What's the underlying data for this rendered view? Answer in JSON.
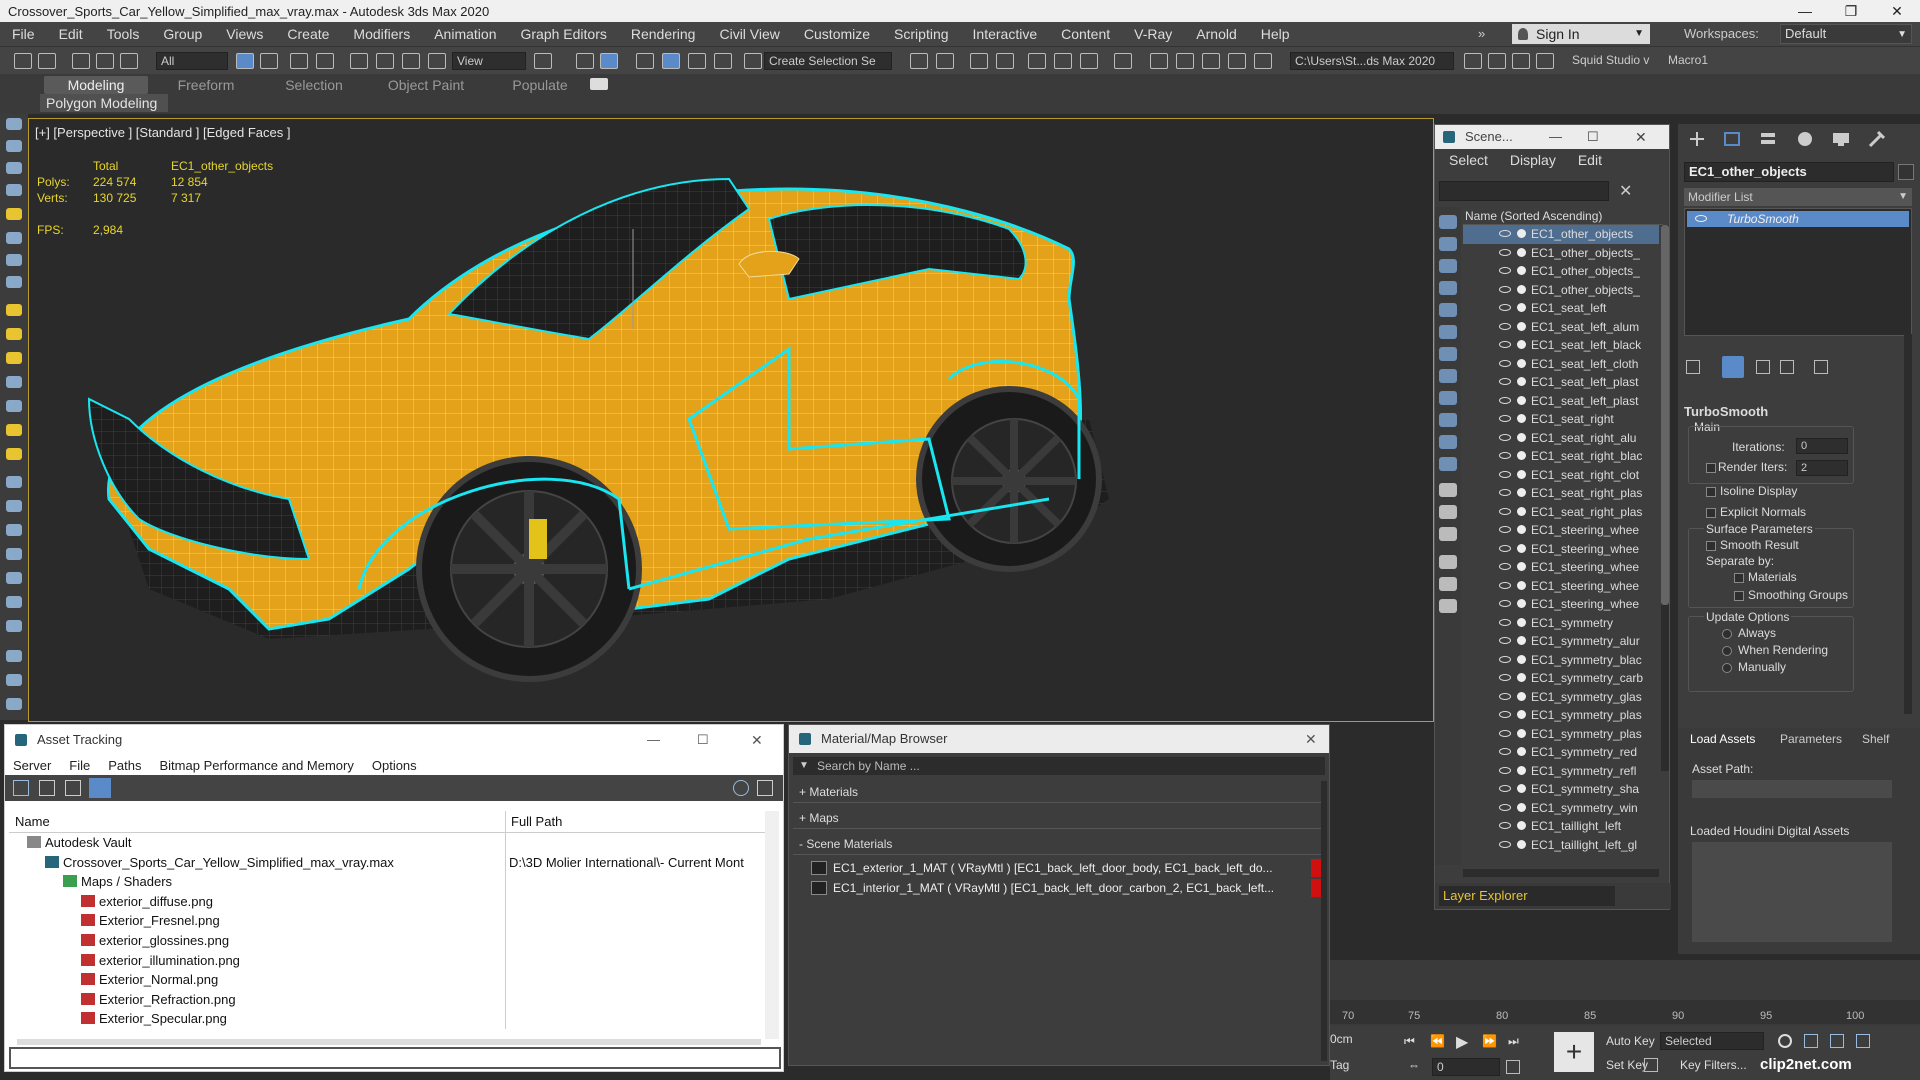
{
  "window": {
    "title": "Crossover_Sports_Car_Yellow_Simplified_max_vray.max - Autodesk 3ds Max 2020",
    "controls": [
      "—",
      "❐",
      "✕"
    ]
  },
  "menu": {
    "items": [
      "File",
      "Edit",
      "Tools",
      "Group",
      "Views",
      "Create",
      "Modifiers",
      "Animation",
      "Graph Editors",
      "Rendering",
      "Civil View",
      "Customize",
      "Scripting",
      "Interactive",
      "Content",
      "V-Ray",
      "Arnold",
      "Help"
    ],
    "more": "»",
    "signin": "Sign In",
    "workspaces_label": "Workspaces:",
    "workspace_value": "Default"
  },
  "toolbar": {
    "filter_value": "All",
    "view_value": "View",
    "selection_set": "Create Selection Se",
    "path": "C:\\Users\\St...ds Max 2020",
    "squid": "Squid Studio v",
    "macro": "Macro1"
  },
  "ribbon": {
    "tabs": [
      "Modeling",
      "Freeform",
      "Selection",
      "Object Paint",
      "Populate"
    ],
    "panel": "Polygon Modeling"
  },
  "viewport": {
    "label": "[+] [Perspective ] [Standard ] [Edged Faces ]",
    "stats": {
      "total_label": "Total",
      "object_label": "EC1_other_objects",
      "polys_label": "Polys:",
      "polys_total": "224 574",
      "polys_obj": "12 854",
      "verts_label": "Verts:",
      "verts_total": "130 725",
      "verts_obj": "7 317",
      "fps_label": "FPS:",
      "fps_value": "2,984"
    },
    "colors": {
      "body": "#e3a21a",
      "selection_outline": "#19e6f0",
      "border": "#b89a2a"
    }
  },
  "scene_explorer": {
    "title": "Scene...",
    "menu": [
      "Select",
      "Display",
      "Edit"
    ],
    "column_header": "Name (Sorted Ascending)",
    "rows": [
      "EC1_other_objects",
      "EC1_other_objects_",
      "EC1_other_objects_",
      "EC1_other_objects_",
      "EC1_seat_left",
      "EC1_seat_left_alum",
      "EC1_seat_left_black",
      "EC1_seat_left_cloth",
      "EC1_seat_left_plast",
      "EC1_seat_left_plast",
      "EC1_seat_right",
      "EC1_seat_right_alu",
      "EC1_seat_right_blac",
      "EC1_seat_right_clot",
      "EC1_seat_right_plas",
      "EC1_seat_right_plas",
      "EC1_steering_whee",
      "EC1_steering_whee",
      "EC1_steering_whee",
      "EC1_steering_whee",
      "EC1_steering_whee",
      "EC1_symmetry",
      "EC1_symmetry_alur",
      "EC1_symmetry_blac",
      "EC1_symmetry_carb",
      "EC1_symmetry_glas",
      "EC1_symmetry_plas",
      "EC1_symmetry_plas",
      "EC1_symmetry_red",
      "EC1_symmetry_refl",
      "EC1_symmetry_sha",
      "EC1_symmetry_win",
      "EC1_taillight_left",
      "EC1_taillight_left_gl"
    ],
    "footer": "Layer Explorer"
  },
  "command_panel": {
    "object_name": "EC1_other_objects",
    "modifier_list": "Modifier List",
    "stack_item": "TurboSmooth",
    "rollout_title": "TurboSmooth",
    "main_label": "Main",
    "iterations_label": "Iterations:",
    "iterations_value": "0",
    "render_iters_label": "Render Iters:",
    "render_iters_value": "2",
    "isoline": "Isoline Display",
    "explicit_normals": "Explicit Normals",
    "surface_params": "Surface Parameters",
    "smooth_result": "Smooth Result",
    "separate_by": "Separate by:",
    "materials": "Materials",
    "smoothing_groups": "Smoothing Groups",
    "update_options": "Update Options",
    "always": "Always",
    "when_rendering": "When Rendering",
    "manually": "Manually",
    "houdini_tabs": [
      "Load Assets",
      "Parameters",
      "Shelf"
    ],
    "asset_path_label": "Asset Path:",
    "loaded_label": "Loaded Houdini Digital Assets"
  },
  "asset_tracking": {
    "title": "Asset Tracking",
    "menu": [
      "Server",
      "File",
      "Paths",
      "Bitmap Performance and Memory",
      "Options"
    ],
    "col_name": "Name",
    "col_path": "Full Path",
    "rows": [
      {
        "name": "Autodesk Vault",
        "path": "",
        "indent": 1,
        "type": "vault"
      },
      {
        "name": "Crossover_Sports_Car_Yellow_Simplified_max_vray.max",
        "path": "D:\\3D Molier International\\- Current Mont",
        "indent": 2,
        "type": "max"
      },
      {
        "name": "Maps / Shaders",
        "path": "",
        "indent": 3,
        "type": "maps"
      },
      {
        "name": "exterior_diffuse.png",
        "path": "",
        "indent": 4,
        "type": "png"
      },
      {
        "name": "Exterior_Fresnel.png",
        "path": "",
        "indent": 4,
        "type": "png"
      },
      {
        "name": "exterior_glossines.png",
        "path": "",
        "indent": 4,
        "type": "png"
      },
      {
        "name": "exterior_illumination.png",
        "path": "",
        "indent": 4,
        "type": "png"
      },
      {
        "name": "Exterior_Normal.png",
        "path": "",
        "indent": 4,
        "type": "png"
      },
      {
        "name": "Exterior_Refraction.png",
        "path": "",
        "indent": 4,
        "type": "png"
      },
      {
        "name": "Exterior_Specular.png",
        "path": "",
        "indent": 4,
        "type": "png"
      }
    ]
  },
  "material_browser": {
    "title": "Material/Map Browser",
    "search_placeholder": "Search by Name ...",
    "sections": [
      "+ Materials",
      "+ Maps",
      "- Scene Materials"
    ],
    "items": [
      "EC1_exterior_1_MAT ( VRayMtl ) [EC1_back_left_door_body, EC1_back_left_do...",
      "EC1_interior_1_MAT ( VRayMtl ) [EC1_back_left_door_carbon_2, EC1_back_left..."
    ]
  },
  "timeline": {
    "ticks": [
      "70",
      "75",
      "80",
      "85",
      "90",
      "95",
      "100"
    ],
    "unit": "0cm",
    "tag": "Tag",
    "auto_key": "Auto Key",
    "set_key": "Set Key",
    "selected": "Selected",
    "key_filters": "Key Filters...",
    "frame": "0",
    "watermark": "clip2net.com"
  }
}
